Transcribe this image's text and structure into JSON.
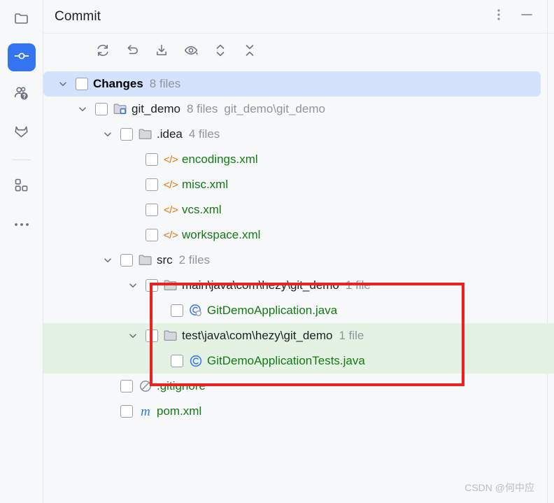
{
  "window": {
    "title": "Commit",
    "menu_icon": "vertical-dots-icon",
    "minimize_icon": "minimize-icon"
  },
  "rail": {
    "items": [
      {
        "icon": "project-folder-icon",
        "name": "project",
        "active": false
      },
      {
        "icon": "commit-icon",
        "name": "commit",
        "active": true
      },
      {
        "icon": "pull-requests-icon",
        "name": "pull-requests",
        "active": false
      },
      {
        "icon": "gitlab-icon",
        "name": "gitlab",
        "active": false
      },
      {
        "icon": "plugins-icon",
        "name": "plugins",
        "active": false
      },
      {
        "icon": "more-icon",
        "name": "more",
        "active": false
      }
    ]
  },
  "toolbar": {
    "buttons": [
      {
        "icon": "refresh-icon",
        "name": "refresh-changes"
      },
      {
        "icon": "rollback-icon",
        "name": "rollback"
      },
      {
        "icon": "shelve-icon",
        "name": "shelve-silently"
      },
      {
        "icon": "eye-icon",
        "name": "show-diff-preview"
      },
      {
        "icon": "expand-collapse-icon",
        "name": "expand-all"
      },
      {
        "icon": "collapse-icon",
        "name": "collapse-all"
      }
    ]
  },
  "tree": {
    "rows": [
      {
        "id": "changes",
        "indent": 0,
        "chevron": "down",
        "checkbox": true,
        "icon": "none",
        "label": "Changes",
        "label_style": "bold",
        "meta": "8 files",
        "path": "",
        "selected": true,
        "green": false
      },
      {
        "id": "git_demo",
        "indent": 1,
        "chevron": "down",
        "checkbox": true,
        "icon": "vcs-folder-icon",
        "label": "git_demo",
        "label_style": "plain",
        "meta": "8 files",
        "path": "git_demo\\git_demo",
        "selected": false,
        "green": false
      },
      {
        "id": "idea",
        "indent": 2,
        "chevron": "down",
        "checkbox": true,
        "icon": "folder-icon",
        "label": ".idea",
        "label_style": "plain",
        "meta": "4 files",
        "path": "",
        "selected": false,
        "green": false
      },
      {
        "id": "encodings",
        "indent": 3,
        "chevron": "none",
        "checkbox": true,
        "icon": "xml-file-icon",
        "label": "encodings.xml",
        "label_style": "added",
        "meta": "",
        "path": "",
        "selected": false,
        "green": false
      },
      {
        "id": "misc",
        "indent": 3,
        "chevron": "none",
        "checkbox": true,
        "icon": "xml-file-icon",
        "label": "misc.xml",
        "label_style": "added",
        "meta": "",
        "path": "",
        "selected": false,
        "green": false
      },
      {
        "id": "vcs",
        "indent": 3,
        "chevron": "none",
        "checkbox": true,
        "icon": "xml-file-icon",
        "label": "vcs.xml",
        "label_style": "added",
        "meta": "",
        "path": "",
        "selected": false,
        "green": false
      },
      {
        "id": "workspace",
        "indent": 3,
        "chevron": "none",
        "checkbox": true,
        "icon": "xml-file-icon",
        "label": "workspace.xml",
        "label_style": "added",
        "meta": "",
        "path": "",
        "selected": false,
        "green": false
      },
      {
        "id": "src",
        "indent": 2,
        "chevron": "down",
        "checkbox": true,
        "icon": "folder-icon",
        "label": "src",
        "label_style": "plain",
        "meta": "2 files",
        "path": "",
        "selected": false,
        "green": false
      },
      {
        "id": "main-pkg",
        "indent": 3,
        "chevron": "down",
        "checkbox": true,
        "icon": "folder-icon",
        "label": "main\\java\\com\\hezy\\git_demo",
        "label_style": "plain",
        "meta": "1 file",
        "path": "",
        "selected": false,
        "green": false
      },
      {
        "id": "gitdemoapplication",
        "indent": 4,
        "chevron": "none",
        "checkbox": true,
        "icon": "java-runnable-class-icon",
        "label": "GitDemoApplication.java",
        "label_style": "added",
        "meta": "",
        "path": "",
        "selected": false,
        "green": false
      },
      {
        "id": "test-pkg",
        "indent": 3,
        "chevron": "down",
        "checkbox": true,
        "icon": "folder-icon",
        "label": "test\\java\\com\\hezy\\git_demo",
        "label_style": "plain",
        "meta": "1 file",
        "path": "",
        "selected": false,
        "green": true
      },
      {
        "id": "gitdemoapplicationtests",
        "indent": 4,
        "chevron": "none",
        "checkbox": true,
        "icon": "java-class-icon",
        "label": "GitDemoApplicationTests.java",
        "label_style": "added",
        "meta": "",
        "path": "",
        "selected": false,
        "green": true
      },
      {
        "id": "gitignore",
        "indent": 2,
        "chevron": "none",
        "checkbox": true,
        "icon": "ignore-file-icon",
        "label": ".gitignore",
        "label_style": "added",
        "meta": "",
        "path": "",
        "selected": false,
        "green": false
      },
      {
        "id": "pom",
        "indent": 2,
        "chevron": "none",
        "checkbox": true,
        "icon": "maven-file-icon",
        "label": "pom.xml",
        "label_style": "added",
        "meta": "",
        "path": "",
        "selected": false,
        "green": false
      }
    ]
  },
  "annotation": {
    "box_color": "#ef2020",
    "highlight_color": "#e4f2e4"
  },
  "watermark": {
    "text": "CSDN @何中应"
  },
  "colors": {
    "accent": "#3574f0",
    "selection": "#d4e2fc",
    "added_text": "#137a13",
    "xml_icon": "#e8700a",
    "background": "#f7f8fa"
  }
}
